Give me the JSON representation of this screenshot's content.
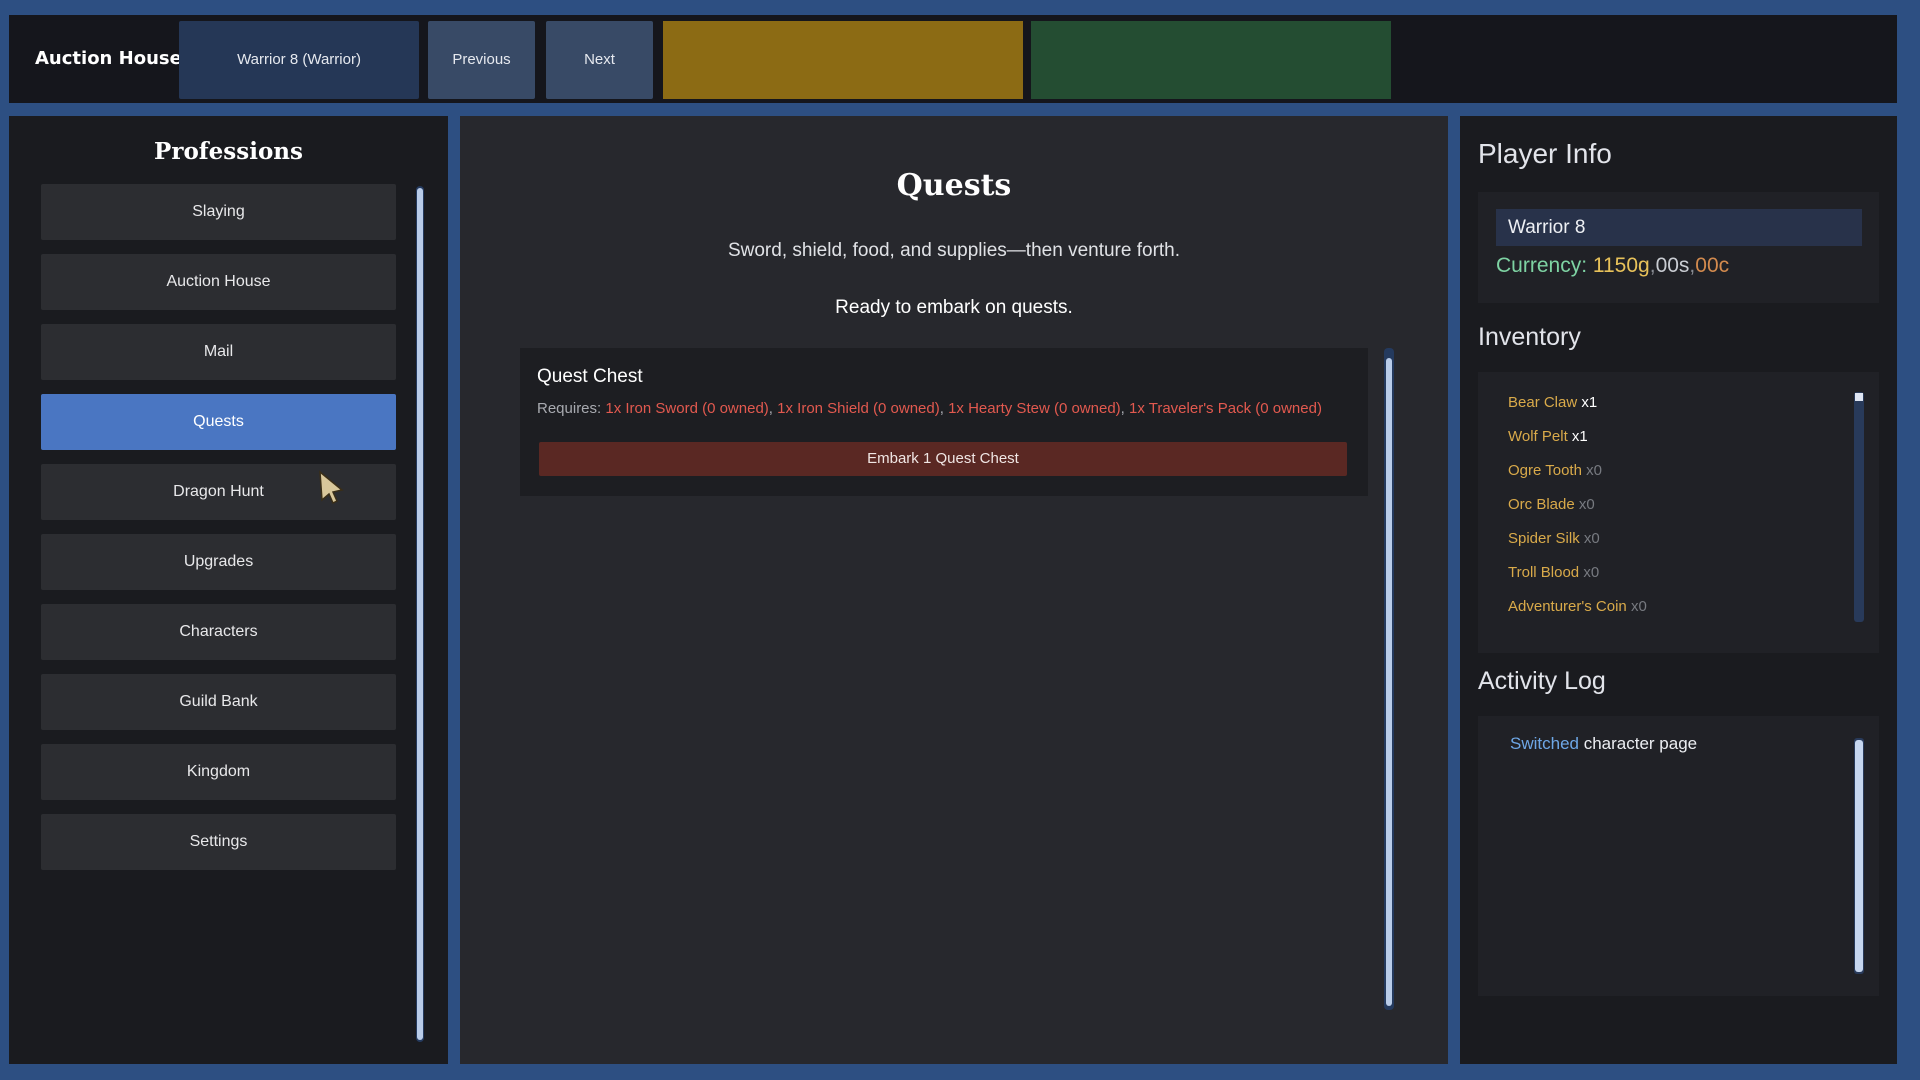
{
  "topbar": {
    "brand": "Auction House",
    "character_select": "Warrior 8 (Warrior)",
    "previous_label": "Previous",
    "next_label": "Next",
    "colors": {
      "gold_box": "#8c6b14",
      "green_box": "#244d32"
    }
  },
  "professions": {
    "title": "Professions",
    "items": [
      {
        "label": "Slaying",
        "active": false
      },
      {
        "label": "Auction House",
        "active": false
      },
      {
        "label": "Mail",
        "active": false
      },
      {
        "label": "Quests",
        "active": true
      },
      {
        "label": "Dragon Hunt",
        "active": false
      },
      {
        "label": "Upgrades",
        "active": false
      },
      {
        "label": "Characters",
        "active": false
      },
      {
        "label": "Guild Bank",
        "active": false
      },
      {
        "label": "Kingdom",
        "active": false
      },
      {
        "label": "Settings",
        "active": false
      }
    ]
  },
  "main": {
    "title": "Quests",
    "subtitle": "Sword, shield, food, and supplies—then venture forth.",
    "status": "Ready to embark on quests.",
    "quest": {
      "name": "Quest Chest",
      "requires_label": "Requires:",
      "requirements": [
        "1x Iron Sword (0 owned)",
        "1x Iron Shield (0 owned)",
        "1x Hearty Stew (0 owned)",
        "1x Traveler's Pack (0 owned)"
      ],
      "embark_label": "Embark 1 Quest Chest"
    }
  },
  "player_info": {
    "title": "Player Info",
    "name": "Warrior 8",
    "currency_label": "Currency:",
    "gold": "1150g",
    "silver": "00s",
    "copper": "00c"
  },
  "inventory": {
    "title": "Inventory",
    "items": [
      {
        "name": "Bear Claw",
        "qty": "x1"
      },
      {
        "name": "Wolf Pelt",
        "qty": "x1"
      },
      {
        "name": "Ogre Tooth",
        "qty": "x0"
      },
      {
        "name": "Orc Blade",
        "qty": "x0"
      },
      {
        "name": "Spider Silk",
        "qty": "x0"
      },
      {
        "name": "Troll Blood",
        "qty": "x0"
      },
      {
        "name": "Adventurer's Coin",
        "qty": "x0"
      }
    ]
  },
  "activity_log": {
    "title": "Activity Log",
    "entries": [
      {
        "keyword": "Switched",
        "text": "character page"
      }
    ]
  },
  "colors": {
    "accent": "#4a76c2",
    "page_bg": "#2d4f82",
    "danger_button": "#5a2823",
    "requirement_text": "#e2594f",
    "item_name": "#d9aa4a"
  }
}
